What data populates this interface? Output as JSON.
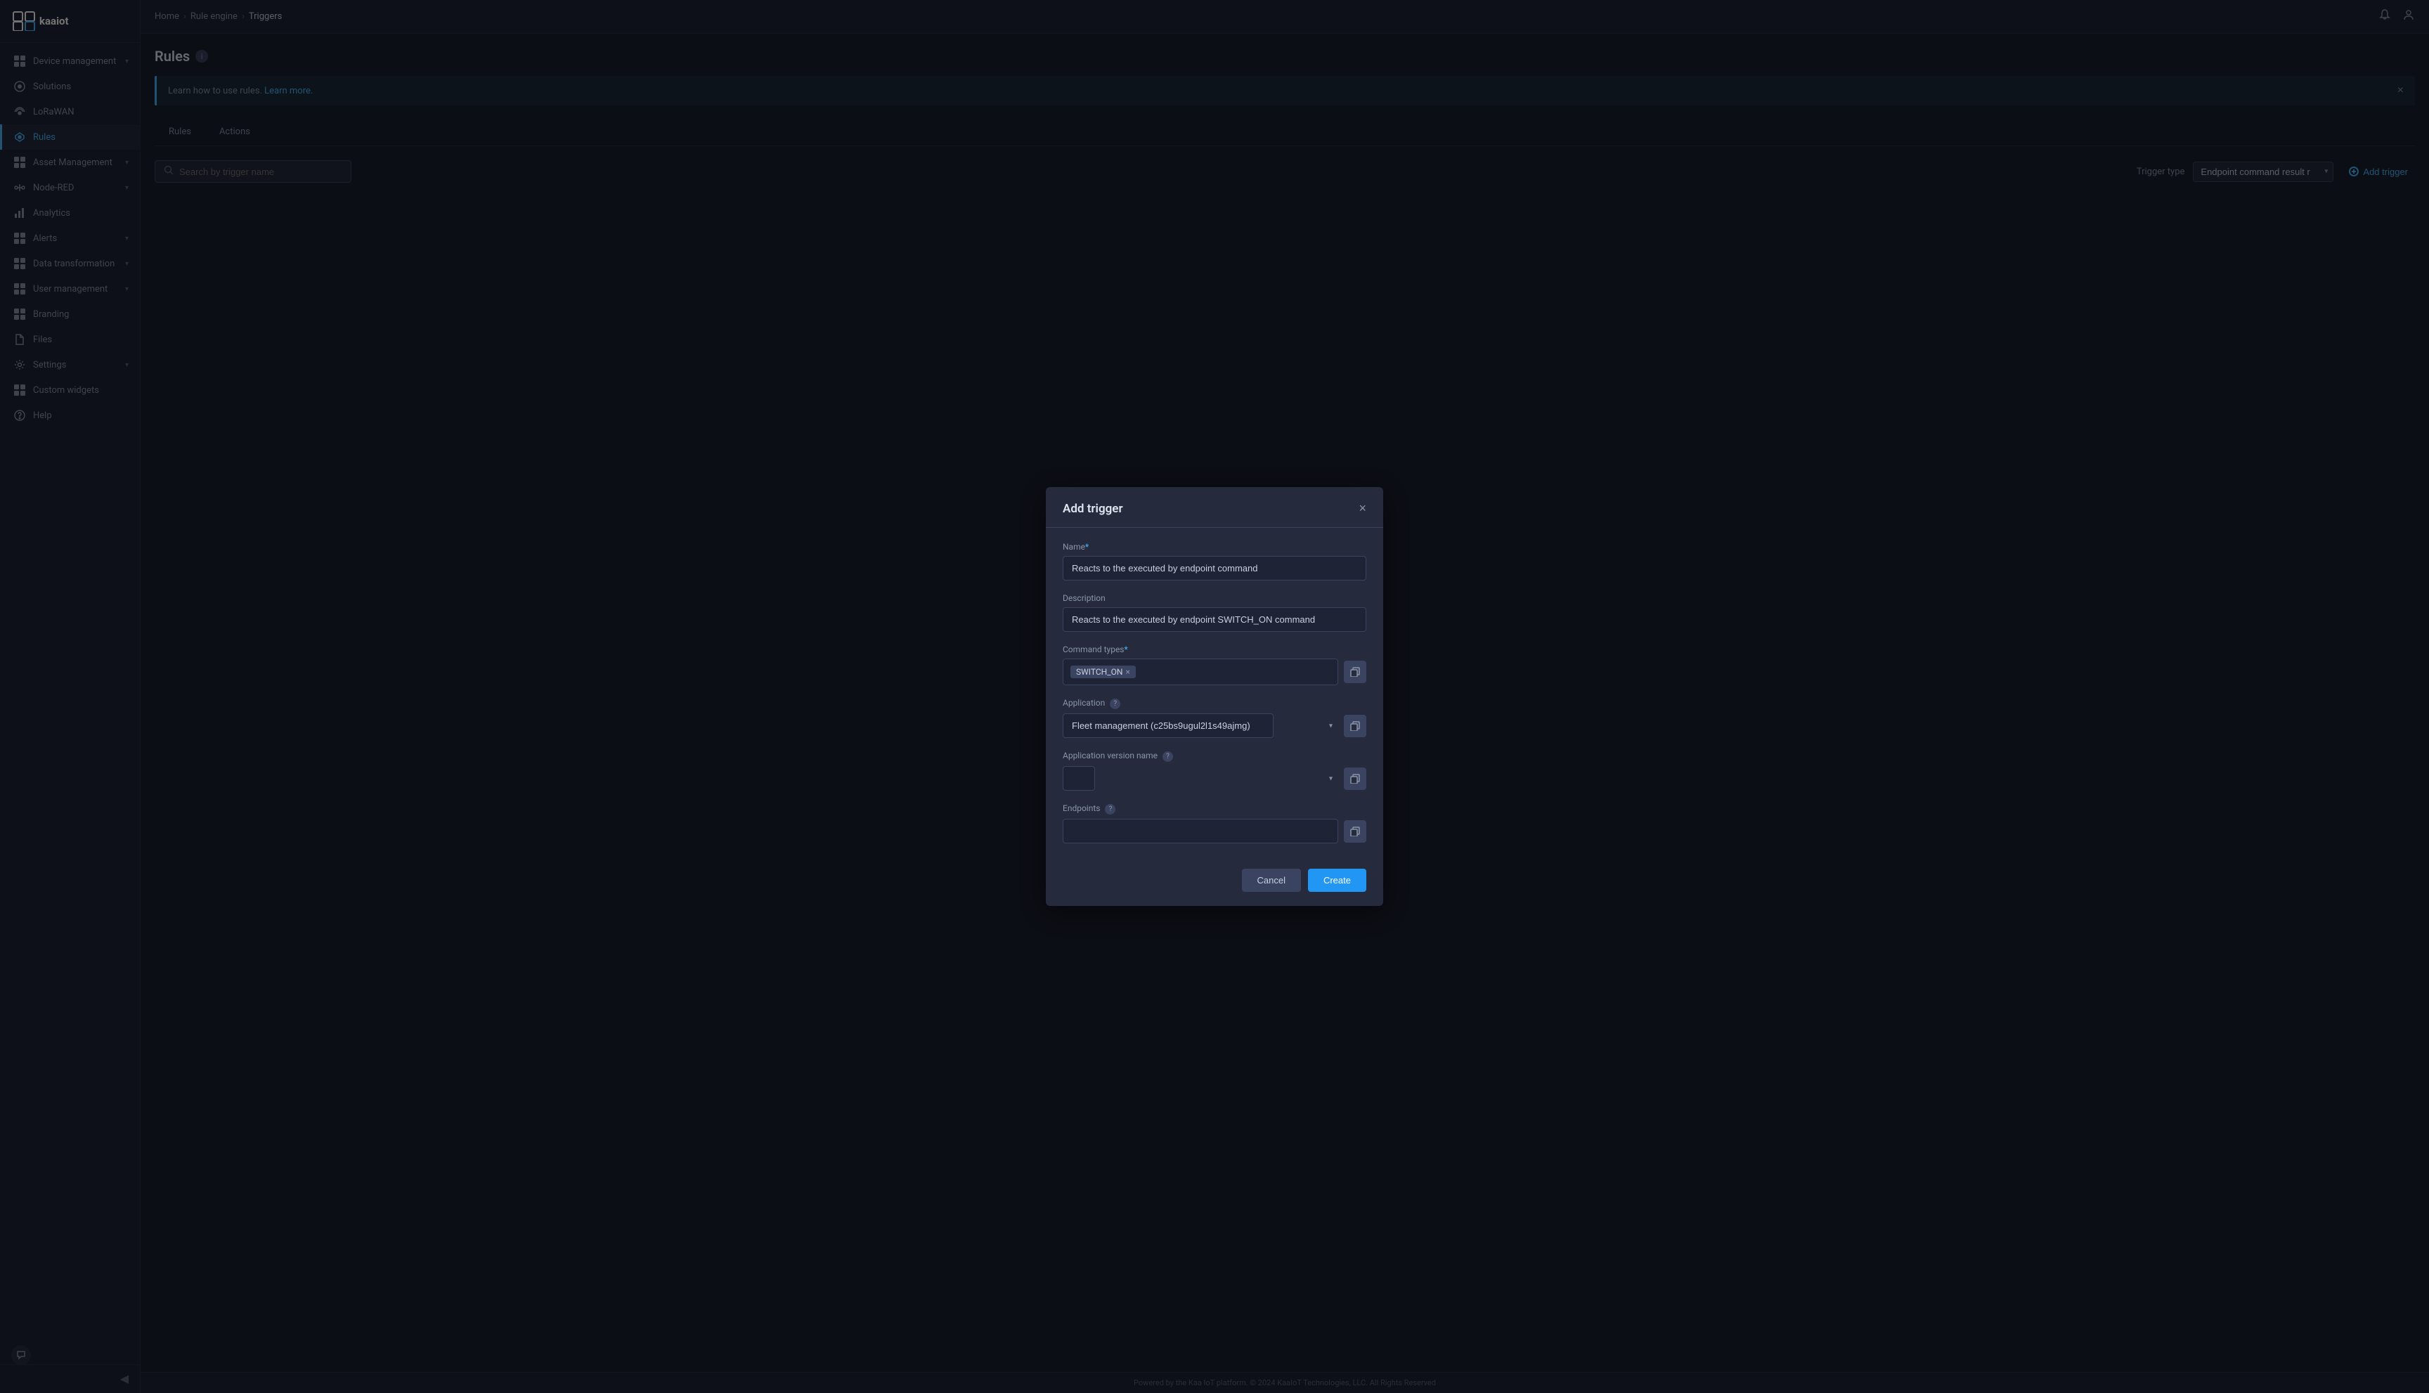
{
  "app": {
    "logo_icon": "□",
    "logo_text": "kaaiot"
  },
  "sidebar": {
    "items": [
      {
        "id": "device-management",
        "label": "Device management",
        "icon": "⊞",
        "hasChevron": true
      },
      {
        "id": "solutions",
        "label": "Solutions",
        "icon": "⊞",
        "hasChevron": false
      },
      {
        "id": "lorawan",
        "label": "LoRaWAN",
        "icon": "◎",
        "hasChevron": false
      },
      {
        "id": "rules",
        "label": "Rules",
        "icon": "◈",
        "hasChevron": false,
        "active": true
      },
      {
        "id": "asset-management",
        "label": "Asset Management",
        "icon": "◫",
        "hasChevron": true
      },
      {
        "id": "node-red",
        "label": "Node-RED",
        "icon": "❋",
        "hasChevron": true
      },
      {
        "id": "analytics",
        "label": "Analytics",
        "icon": "⊞",
        "hasChevron": false
      },
      {
        "id": "alerts",
        "label": "Alerts",
        "icon": "⊞",
        "hasChevron": true
      },
      {
        "id": "data-transformation",
        "label": "Data transformation",
        "icon": "⊞",
        "hasChevron": true
      },
      {
        "id": "user-management",
        "label": "User management",
        "icon": "⊞",
        "hasChevron": true
      },
      {
        "id": "branding",
        "label": "Branding",
        "icon": "⊞",
        "hasChevron": false
      },
      {
        "id": "files",
        "label": "Files",
        "icon": "⊞",
        "hasChevron": false
      },
      {
        "id": "settings",
        "label": "Settings",
        "icon": "⊞",
        "hasChevron": true
      },
      {
        "id": "custom-widgets",
        "label": "Custom widgets",
        "icon": "⊞",
        "hasChevron": false
      },
      {
        "id": "help",
        "label": "Help",
        "icon": "⊞",
        "hasChevron": false
      }
    ]
  },
  "topbar": {
    "breadcrumbs": [
      "Home",
      "Rule engine",
      "Triggers"
    ],
    "bell_icon": "🔔",
    "user_icon": "👤"
  },
  "page": {
    "title": "Rules",
    "info_badge": "i",
    "banner_text": "Learn how to use rules.",
    "banner_link": "Learn more.",
    "banner_link_url": "#"
  },
  "tabs": [
    {
      "id": "rules",
      "label": "Rules",
      "active": false
    },
    {
      "id": "actions",
      "label": "Actions",
      "active": false
    }
  ],
  "toolbar": {
    "search_placeholder": "Search by trigger name",
    "trigger_type_label": "Trigger type",
    "trigger_type_value": "Endpoint command result r",
    "add_trigger_label": "Add trigger"
  },
  "modal": {
    "title": "Add trigger",
    "close_icon": "×",
    "fields": {
      "name_label": "Name",
      "name_required": "*",
      "name_value": "Reacts to the executed by endpoint command",
      "description_label": "Description",
      "description_value": "Reacts to the executed by endpoint SWITCH_ON command",
      "command_types_label": "Command types",
      "command_types_required": "*",
      "command_types_tag": "SWITCH_ON",
      "application_label": "Application",
      "application_help": "?",
      "application_value": "Fleet management (c25bs9ugul2l1s49ajmg)",
      "application_version_label": "Application version name",
      "application_version_help": "?",
      "application_version_value": "",
      "endpoints_label": "Endpoints",
      "endpoints_help": "?",
      "endpoints_value": ""
    },
    "cancel_label": "Cancel",
    "create_label": "Create"
  },
  "footer": {
    "text": "Powered by the Kaa IoT platform. © 2024 KaaIoT Technologies, LLC. All Rights Reserved"
  }
}
